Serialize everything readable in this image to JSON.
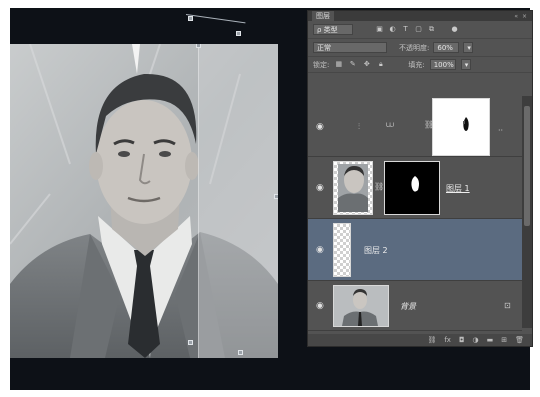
{
  "panel": {
    "tab_title": "图层",
    "collapse_glyph": "« ×",
    "menu_glyph": "≡",
    "filter": {
      "kind_label": "ρ 类型",
      "icons": [
        "image-filter-icon",
        "adjust-filter-icon",
        "type-filter-icon",
        "shape-filter-icon",
        "smart-filter-icon"
      ]
    },
    "blend_mode": "正常",
    "opacity_label": "不透明度:",
    "opacity_value": "60%",
    "lock_label": "锁定:",
    "fill_label": "填充:",
    "fill_value": "100%"
  },
  "layers": [
    {
      "name": "",
      "type": "adjustment",
      "selected": false,
      "visible": true
    },
    {
      "name": "图层 1",
      "type": "masked",
      "selected": false,
      "visible": true
    },
    {
      "name": "图层 2",
      "type": "transparent",
      "selected": true,
      "visible": true
    },
    {
      "name": "背景",
      "type": "background",
      "selected": false,
      "visible": true,
      "locked": true
    }
  ],
  "bottom_bar": {
    "icons": [
      "link-layers-icon",
      "fx-icon",
      "mask-icon",
      "adjustment-icon",
      "group-icon",
      "new-layer-icon",
      "delete-icon"
    ]
  },
  "colors": {
    "selected_row": "#5b6b80",
    "panel_bg": "#535353",
    "workspace": "#0d1117"
  }
}
